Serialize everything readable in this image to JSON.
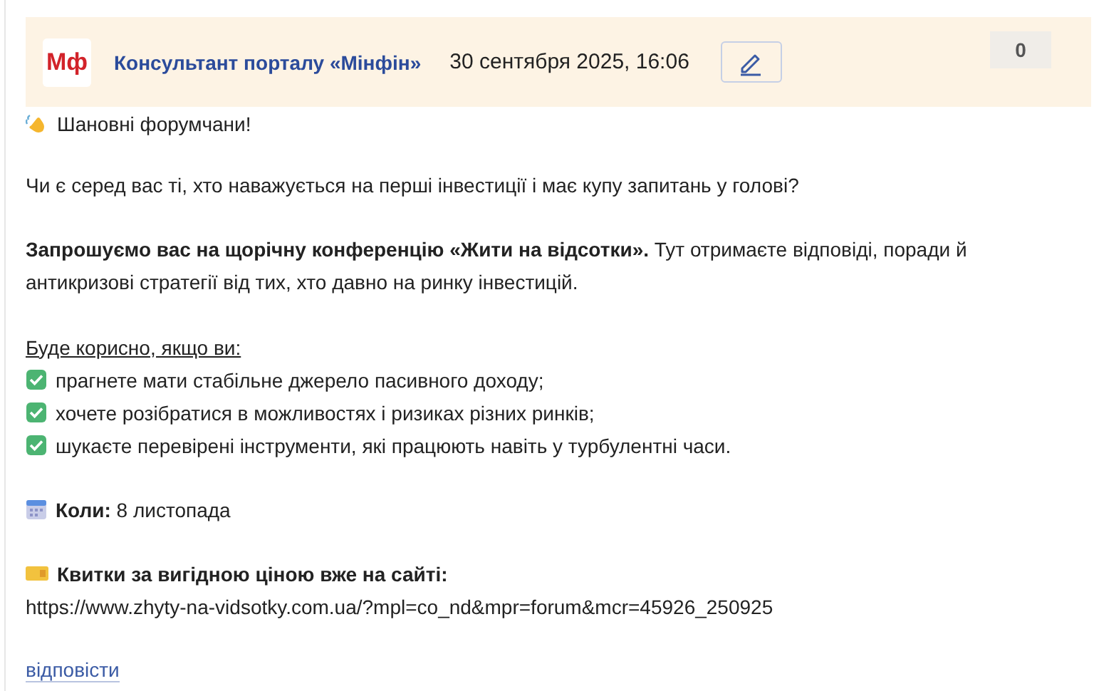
{
  "post": {
    "logo": "Мф",
    "author": "Консультант порталу «Мінфін»",
    "date": "30 сентября 2025, 16:06",
    "counter": "0",
    "body": [
      {
        "kind": "greeting",
        "text": "Шановні форумчани!"
      },
      {
        "kind": "paragraph",
        "text": "Чи є серед вас ті, хто наважується на перші інвестиції і має купу запитань у голові?"
      },
      {
        "kind": "paragraph",
        "text": "**Запрошуємо вас на щорічну конференцію «Жити на відсотки».** Тут отримаєте відповіді, поради й антикризові стратегії від тих, хто давно на ринку інвестицій."
      },
      {
        "kind": "list",
        "title": "Буде корисно, якщо ви:",
        "items": [
          "прагнете мати стабільне джерело пасивного доходу;",
          "хочете розібратися в можливостях і ризиках різних ринків;",
          "шукаєте перевірені інструменти, які працюють навіть у турбулентні часи."
        ]
      },
      {
        "kind": "date",
        "text": "**Коли:** 8 листопада"
      },
      {
        "kind": "tickets",
        "text": "Квитки за вигідною ціною вже на сайті:",
        "url": "https://www.zhyty-na-vidsotky.com.ua/?mpl=co_nd&mpr=forum&mcr=45926_250925"
      }
    ],
    "reply": "відповісти"
  }
}
